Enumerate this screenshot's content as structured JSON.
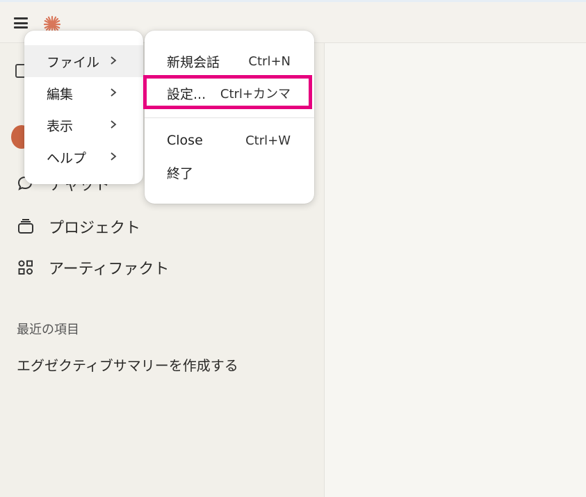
{
  "titlebar": {
    "menu_icon": "hamburger-icon",
    "logo_icon": "claude-sunburst-icon"
  },
  "sidebar": {
    "nav": [
      {
        "label": "チャット",
        "icon": "chat-bubbles-icon"
      },
      {
        "label": "プロジェクト",
        "icon": "project-box-icon"
      },
      {
        "label": "アーティファクト",
        "icon": "artifacts-icon"
      }
    ],
    "recent_title": "最近の項目",
    "recent_items": [
      "エグゼクティブサマリーを作成する"
    ]
  },
  "menu": {
    "items": [
      {
        "label": "ファイル"
      },
      {
        "label": "編集"
      },
      {
        "label": "表示"
      },
      {
        "label": "ヘルプ"
      }
    ]
  },
  "submenu": {
    "items": [
      {
        "label": "新規会話",
        "shortcut": "Ctrl+N"
      },
      {
        "label": "設定...",
        "shortcut": "Ctrl+カンマ"
      },
      {
        "label": "Close",
        "shortcut": "Ctrl+W"
      },
      {
        "label": "終了",
        "shortcut": ""
      }
    ]
  },
  "colors": {
    "accent": "#c96442",
    "highlight": "#e6007e",
    "background": "#f4f2ed"
  }
}
